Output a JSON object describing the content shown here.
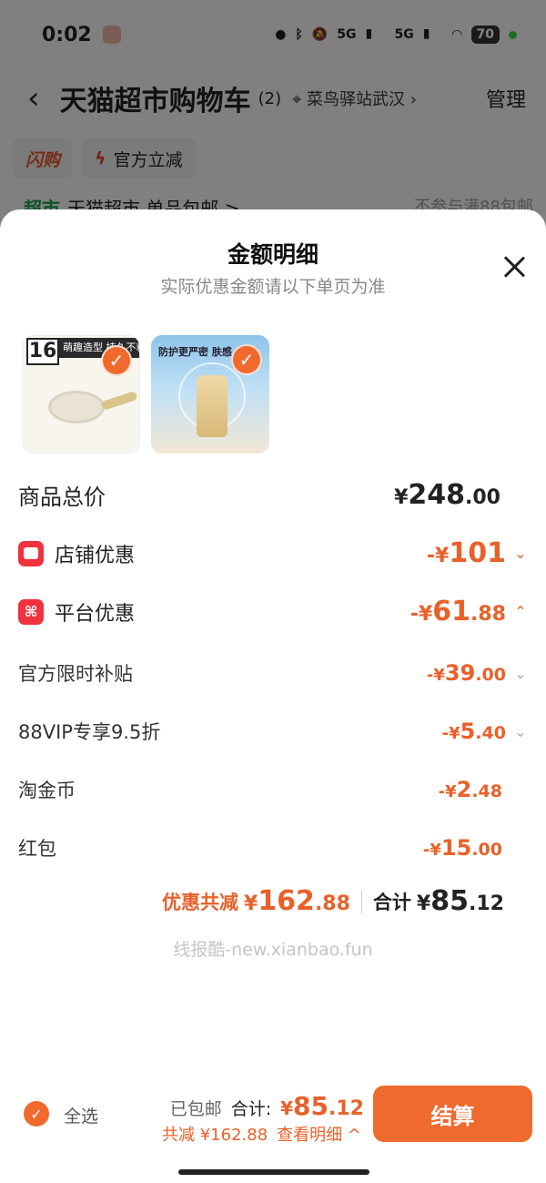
{
  "status_bar": {
    "time": "0:02",
    "network_1": "5G",
    "network_2": "5G",
    "battery": "70"
  },
  "cart_header": {
    "title": "天猫超市购物车",
    "count": "(2)",
    "location": "菜鸟驿站武汉",
    "manage": "管理"
  },
  "chips": {
    "flash": "闪购",
    "discount": "官方立减"
  },
  "store_row": {
    "tag": "超市",
    "name": "天猫超市 单品包邮 >",
    "note": "不参与满88包邮"
  },
  "sheet": {
    "title": "金额明细",
    "subtitle": "实际优惠金额请以下单页为准",
    "thumb1": {
      "badge": "16",
      "banner": "萌趣造型 持久不粘"
    },
    "thumb2": {
      "banner": "防护更严密 肤感"
    },
    "rows": {
      "total_price": {
        "label": "商品总价",
        "cur": "¥",
        "int": "248",
        "dec": ".00"
      },
      "store_discount": {
        "label": "店铺优惠",
        "cur": "-¥",
        "int": "101",
        "dec": ""
      },
      "platform_discount": {
        "label": "平台优惠",
        "cur": "-¥",
        "int": "61",
        "dec": ".88"
      },
      "official_subsidy": {
        "label": "官方限时补贴",
        "cur": "-¥",
        "int": "39",
        "dec": ".00"
      },
      "vip": {
        "label": "88VIP专享9.5折",
        "cur": "-¥",
        "int": "5",
        "dec": ".40"
      },
      "taojinbi": {
        "label": "淘金币",
        "cur": "-¥",
        "int": "2",
        "dec": ".48"
      },
      "hongbao": {
        "label": "红包",
        "cur": "-¥",
        "int": "15",
        "dec": ".00"
      }
    },
    "totals": {
      "discount_label": "优惠共减",
      "discount_cur": "¥",
      "discount_int": "162",
      "discount_dec": ".88",
      "sum_label": "合计",
      "sum_cur": "¥",
      "sum_int": "85",
      "sum_dec": ".12"
    },
    "watermark": "线报酷-new.xianbao.fun"
  },
  "bottom_bar": {
    "select_all": "全选",
    "free_ship": "已包邮",
    "total_label": "合计:",
    "cur": "¥",
    "int": "85",
    "dec": ".12",
    "saved": "共减 ¥162.88",
    "view_detail": "查看明细 ^",
    "checkout": "结算"
  }
}
